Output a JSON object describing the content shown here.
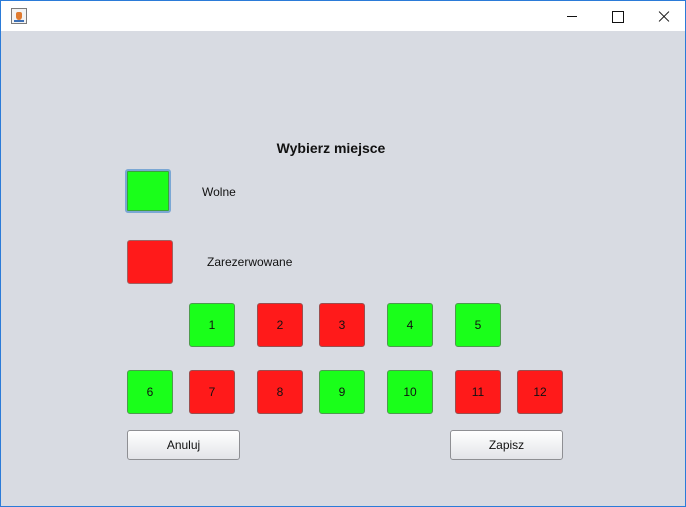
{
  "window": {
    "title": "",
    "controls": [
      "minimize",
      "maximize",
      "close"
    ]
  },
  "heading": "Wybierz miejsce",
  "legend": {
    "free": {
      "label": "Wolne",
      "color": "#1aff1a"
    },
    "reserved": {
      "label": "Zarezerwowane",
      "color": "#ff1a1a"
    }
  },
  "seats": [
    {
      "number": "1",
      "status": "free"
    },
    {
      "number": "2",
      "status": "reserved"
    },
    {
      "number": "3",
      "status": "reserved"
    },
    {
      "number": "4",
      "status": "free"
    },
    {
      "number": "5",
      "status": "free"
    },
    {
      "number": "6",
      "status": "free"
    },
    {
      "number": "7",
      "status": "reserved"
    },
    {
      "number": "8",
      "status": "reserved"
    },
    {
      "number": "9",
      "status": "free"
    },
    {
      "number": "10",
      "status": "free"
    },
    {
      "number": "11",
      "status": "reserved"
    },
    {
      "number": "12",
      "status": "reserved"
    }
  ],
  "buttons": {
    "cancel": "Anuluj",
    "save": "Zapisz"
  }
}
